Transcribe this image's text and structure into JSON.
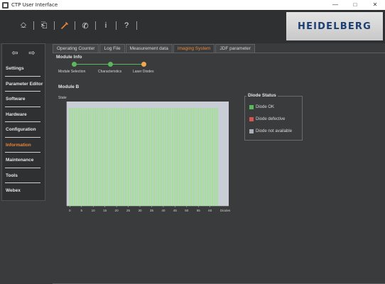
{
  "window": {
    "title": "CTP User Interface",
    "controls": [
      "—",
      "□",
      "✕"
    ]
  },
  "toolbar": {
    "buttons": [
      {
        "icon": "device-icon",
        "glyph": "⎐"
      },
      {
        "icon": "export-icon",
        "glyph": "⎗"
      },
      {
        "icon": "wrench-icon",
        "glyph": "🔧"
      },
      {
        "icon": "phone-icon",
        "glyph": "✆"
      },
      {
        "icon": "info-icon",
        "glyph": "i"
      },
      {
        "icon": "help-icon",
        "glyph": "?"
      }
    ]
  },
  "brand": {
    "logo_text": "HEIDELBERG"
  },
  "sidebar": {
    "items": [
      {
        "label": "Settings",
        "active": false
      },
      {
        "label": "Parameter Editor",
        "active": false
      },
      {
        "label": "Software",
        "active": false
      },
      {
        "label": "Hardware",
        "active": false
      },
      {
        "label": "Configuration",
        "active": false
      },
      {
        "label": "Information",
        "active": true
      },
      {
        "label": "Maintenance",
        "active": false
      },
      {
        "label": "Tools",
        "active": false
      },
      {
        "label": "Webex",
        "active": false
      }
    ]
  },
  "tabs": [
    {
      "label": "Operating Counter",
      "active": false
    },
    {
      "label": "Log File",
      "active": false
    },
    {
      "label": "Measurement data",
      "active": false
    },
    {
      "label": "Imaging System",
      "active": true
    },
    {
      "label": "JDF parameter",
      "active": false
    }
  ],
  "module_info": {
    "title": "Module Info",
    "steps": [
      {
        "label": "Module Selection",
        "status": "done"
      },
      {
        "label": "Characteristics",
        "status": "done"
      },
      {
        "label": "Laser Diodes",
        "status": "current"
      }
    ]
  },
  "module": {
    "title": "Module B"
  },
  "chart_data": {
    "type": "bar",
    "ylabel": "State",
    "xlabel": "Diodes",
    "x_ticks": [
      0,
      5,
      10,
      15,
      20,
      25,
      30,
      35,
      40,
      45,
      50,
      55,
      60
    ],
    "diode_count": 64,
    "values": [
      1,
      1,
      1,
      1,
      1,
      1,
      1,
      1,
      1,
      1,
      1,
      1,
      1,
      1,
      1,
      1,
      1,
      1,
      1,
      1,
      1,
      1,
      1,
      1,
      1,
      1,
      1,
      1,
      1,
      1,
      1,
      1,
      1,
      1,
      1,
      1,
      1,
      1,
      1,
      1,
      1,
      1,
      1,
      1,
      1,
      1,
      1,
      1,
      1,
      1,
      1,
      1,
      1,
      1,
      1,
      1,
      1,
      1,
      1,
      1,
      1,
      1,
      1,
      1
    ],
    "value_meaning": "1 = Diode OK",
    "bar_color": "#a8dca0",
    "plot_background": "#c9cdd6",
    "grid": false
  },
  "legend": {
    "title": "Diode Status",
    "items": [
      {
        "label": "Diode OK",
        "color": "#5cb85c"
      },
      {
        "label": "Diode defective",
        "color": "#d9534f"
      },
      {
        "label": "Diode not available",
        "color": "#a8aeb8"
      }
    ]
  },
  "colors": {
    "accent": "#e8863a",
    "step_done": "#5cb85c",
    "step_current": "#f0a84a"
  }
}
